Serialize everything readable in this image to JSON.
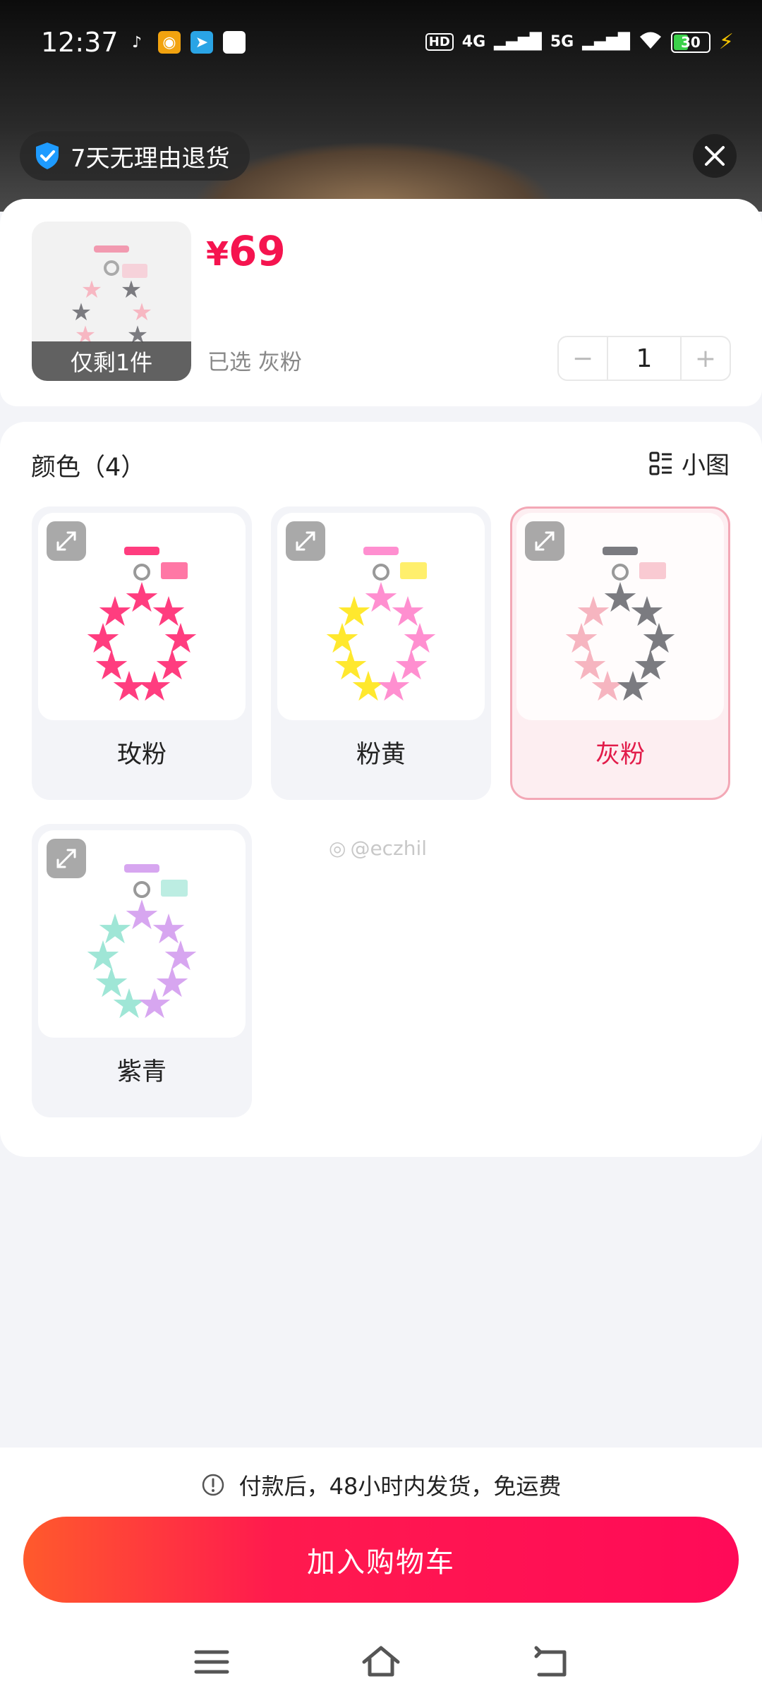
{
  "status_bar": {
    "time": "12:37",
    "app_icons": [
      "tiktok-icon",
      "weibo-icon",
      "telegram-icon",
      "white-square-icon"
    ],
    "network_hd": "HD",
    "network_4g": "4G",
    "network_5g": "5G",
    "battery": "30"
  },
  "policy": {
    "label": "7天无理由退货"
  },
  "product": {
    "currency": "¥",
    "price": "69",
    "stock_tag": "仅剩1件",
    "selected_text": "已选 灰粉",
    "quantity": "1",
    "minus": "−",
    "plus": "+"
  },
  "options": {
    "title": "颜色（4）",
    "view_toggle": "小图",
    "swatches": [
      {
        "label": "玫粉",
        "selected": false,
        "colors": [
          "#ff3d7f",
          "#ff3d7f"
        ]
      },
      {
        "label": "粉黄",
        "selected": false,
        "colors": [
          "#ff8fd0",
          "#ffe82e"
        ]
      },
      {
        "label": "灰粉",
        "selected": true,
        "colors": [
          "#7b7b80",
          "#f6b5c0"
        ]
      },
      {
        "label": "紫青",
        "selected": false,
        "colors": [
          "#d7a6f0",
          "#9fe6d6"
        ]
      }
    ],
    "watermark": "@eczhil"
  },
  "bottom": {
    "shipping_note": "付款后，48小时内发货，免运费",
    "cart_button": "加入购物车"
  },
  "colors": {
    "accent": "#f5144f",
    "selected_border": "#f3a8b6"
  }
}
